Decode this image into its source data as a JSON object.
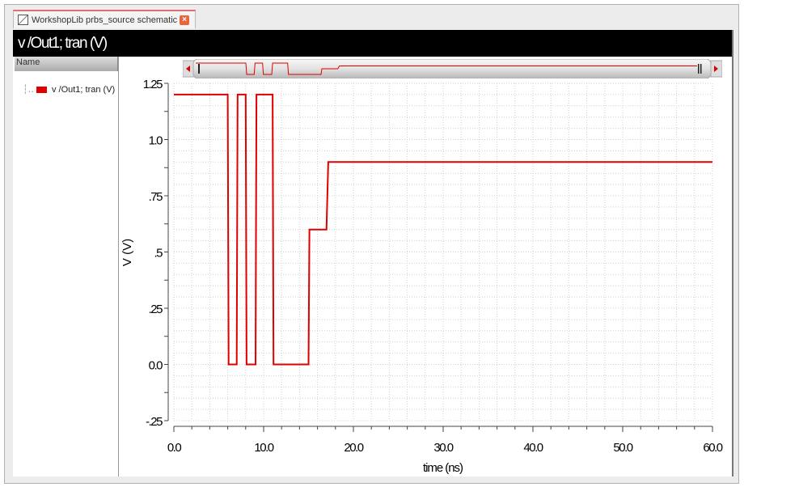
{
  "tab": {
    "title": "WorkshopLib prbs_source schematic",
    "close_icon": "close-icon"
  },
  "window": {
    "title": "v /Out1; tran (V)"
  },
  "sidebar": {
    "header": "Name",
    "items": [
      {
        "label": "v /Out1; tran (V)",
        "color": "#e00000"
      }
    ]
  },
  "chart_data": {
    "type": "line",
    "xlabel": "time (ns)",
    "ylabel": "V (V)",
    "xlim": [
      0,
      60
    ],
    "ylim": [
      -0.25,
      1.25
    ],
    "xticks": [
      {
        "v": 0,
        "label": "0.0"
      },
      {
        "v": 10,
        "label": "10.0"
      },
      {
        "v": 20,
        "label": "20.0"
      },
      {
        "v": 30,
        "label": "30.0"
      },
      {
        "v": 40,
        "label": "40.0"
      },
      {
        "v": 50,
        "label": "50.0"
      },
      {
        "v": 60,
        "label": "60.0"
      }
    ],
    "yticks": [
      {
        "v": 1.25,
        "label": "1.25"
      },
      {
        "v": 1.0,
        "label": "1.0"
      },
      {
        "v": 0.75,
        "label": ".75"
      },
      {
        "v": 0.5,
        "label": ".5"
      },
      {
        "v": 0.25,
        "label": ".25"
      },
      {
        "v": 0,
        "label": "0.0"
      },
      {
        "v": -0.25,
        "label": "-.25"
      }
    ],
    "grid": true,
    "series": [
      {
        "name": "v /Out1; tran (V)",
        "color": "#e00000",
        "x": [
          0,
          6,
          6.1,
          7,
          7.1,
          8,
          8.1,
          9.1,
          9.2,
          11,
          11.1,
          15,
          15.1,
          17,
          17.2,
          60
        ],
        "y": [
          1.2,
          1.2,
          0,
          0,
          1.2,
          1.2,
          0,
          0,
          1.2,
          1.2,
          0,
          0,
          0.6,
          0.6,
          0.9,
          0.9
        ]
      }
    ]
  }
}
